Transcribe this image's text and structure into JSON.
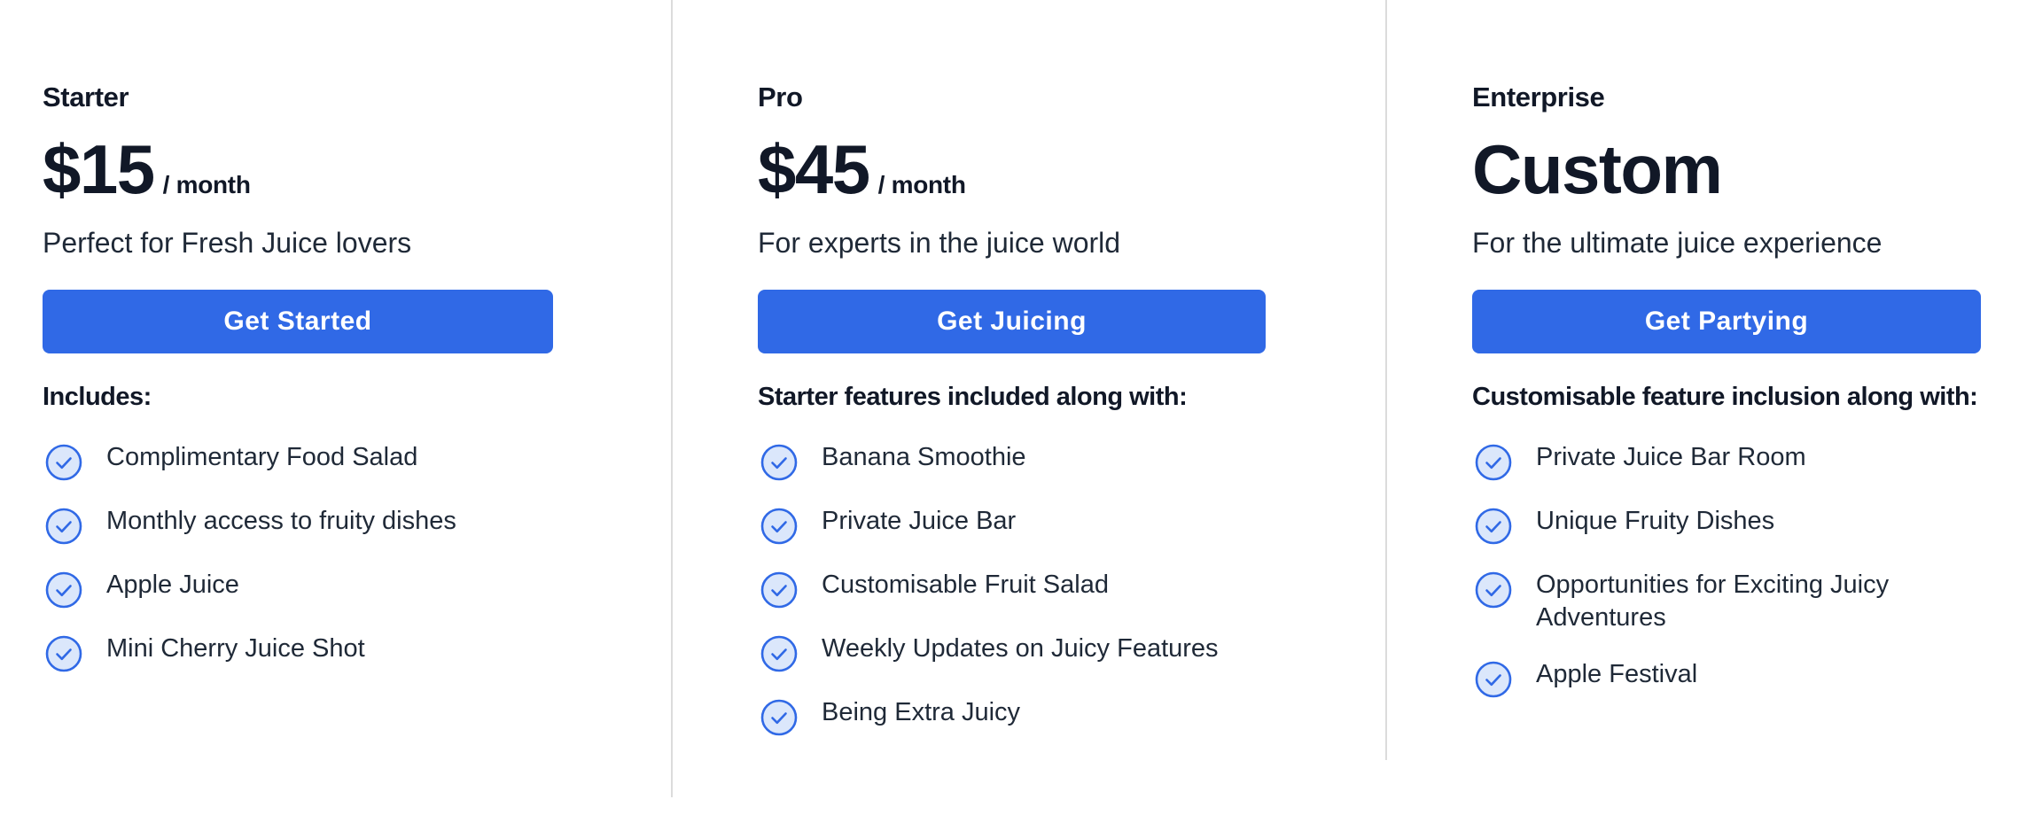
{
  "colors": {
    "accent": "#3069e6",
    "text": "#111827",
    "divider": "#dcdcdc",
    "check_fill": "#dbe7fb",
    "check_stroke": "#3069e6"
  },
  "plans": [
    {
      "name": "Starter",
      "price": "$15",
      "period": "/ month",
      "tagline": "Perfect for Fresh Juice lovers",
      "cta": "Get Started",
      "includes_heading": "Includes:",
      "features": [
        "Complimentary Food Salad",
        "Monthly access to fruity dishes",
        "Apple Juice",
        "Mini Cherry Juice Shot"
      ]
    },
    {
      "name": "Pro",
      "price": "$45",
      "period": "/ month",
      "tagline": "For experts in the juice world",
      "cta": "Get Juicing",
      "includes_heading": "Starter features included along with:",
      "features": [
        "Banana Smoothie",
        "Private Juice Bar",
        "Customisable Fruit Salad",
        "Weekly Updates on Juicy Features",
        "Being Extra Juicy"
      ]
    },
    {
      "name": "Enterprise",
      "price": "Custom",
      "period": "",
      "tagline": "For the ultimate juice experience",
      "cta": "Get Partying",
      "includes_heading": "Customisable feature inclusion along with:",
      "features": [
        "Private Juice Bar Room",
        "Unique Fruity Dishes",
        "Opportunities for Exciting Juicy Adventures",
        "Apple Festival"
      ]
    }
  ],
  "icons": {
    "feature_check": "check-circle-icon"
  }
}
